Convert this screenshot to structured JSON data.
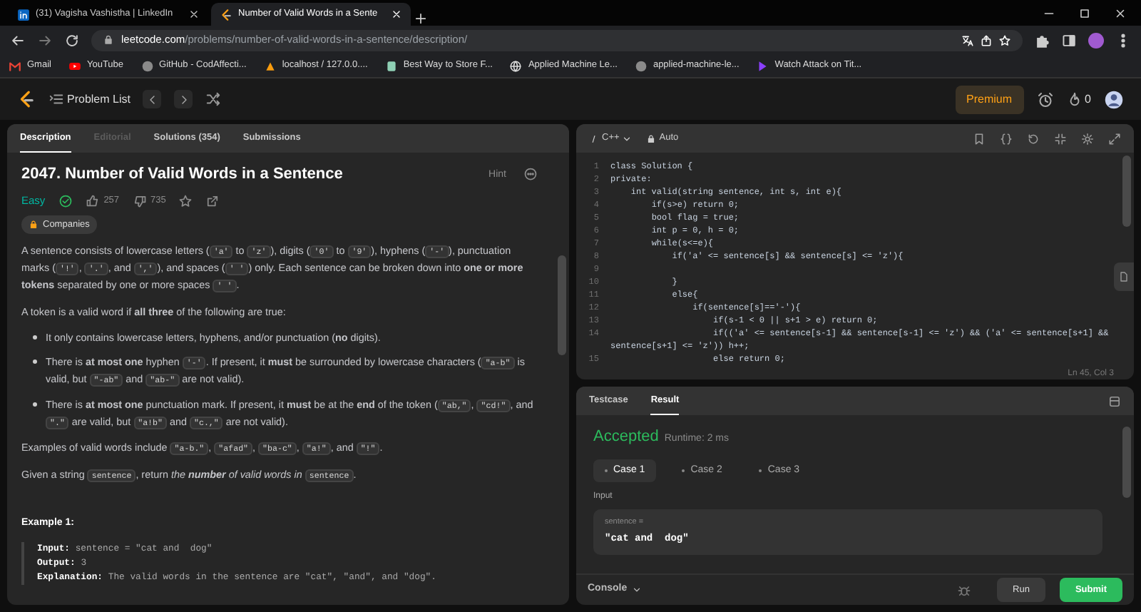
{
  "browser": {
    "tabs": [
      {
        "title": "(31) Vagisha Vashistha | LinkedIn",
        "kind": "square",
        "selected": false
      },
      {
        "title": "Number of Valid Words in a Sente",
        "kind": "bracket",
        "selected": true
      }
    ],
    "url_host": "leetcode.com",
    "url_path": "/problems/number-of-valid-words-in-a-sentence/description/",
    "bookmarks": [
      {
        "label": "Gmail",
        "kind": "mail"
      },
      {
        "label": "YouTube",
        "kind": "video"
      },
      {
        "label": "GitHub - CodAffecti...",
        "kind": "round"
      },
      {
        "label": "localhost / 127.0.0....",
        "kind": "sail"
      },
      {
        "label": "Best Way to Store F...",
        "kind": "page"
      },
      {
        "label": "Applied Machine Le...",
        "kind": "globe"
      },
      {
        "label": "applied-machine-le...",
        "kind": "round"
      },
      {
        "label": "Watch Attack on Tit...",
        "kind": "play"
      }
    ]
  },
  "nav": {
    "title": "Problem List",
    "premium": "Premium",
    "streak": "0"
  },
  "left": {
    "tabs": [
      {
        "label": "Description",
        "selected": true,
        "disabled": false
      },
      {
        "label": "Editorial",
        "selected": false,
        "disabled": true
      },
      {
        "label": "Solutions (354)",
        "selected": false,
        "disabled": false
      },
      {
        "label": "Submissions",
        "selected": false,
        "disabled": false
      }
    ]
  },
  "problem": {
    "title": "2047. Number of Valid Words in a Sentence",
    "hint": "Hint",
    "difficulty": "Easy",
    "solved": true,
    "likes": "257",
    "dislikes": "735",
    "tag": "Companies",
    "blocks": [
      {
        "kind": "paragraph",
        "segments": [
          {
            "kind": "text",
            "text": "A sentence consists of lowercase letters ("
          },
          {
            "kind": "code",
            "text": "'a'"
          },
          {
            "kind": "text",
            "text": " to "
          },
          {
            "kind": "code",
            "text": "'z'"
          },
          {
            "kind": "text",
            "text": "), digits ("
          },
          {
            "kind": "code",
            "text": "'0'"
          },
          {
            "kind": "text",
            "text": " to "
          },
          {
            "kind": "code",
            "text": "'9'"
          },
          {
            "kind": "text",
            "text": "), hyphens ("
          },
          {
            "kind": "code",
            "text": "'-'"
          },
          {
            "kind": "text",
            "text": "), punctuation marks ("
          },
          {
            "kind": "code",
            "text": "'!'"
          },
          {
            "kind": "text",
            "text": ", "
          },
          {
            "kind": "code",
            "text": "'.'"
          },
          {
            "kind": "text",
            "text": ", and "
          },
          {
            "kind": "code",
            "text": "','"
          },
          {
            "kind": "text",
            "text": "), and spaces ("
          },
          {
            "kind": "code",
            "text": "' '"
          },
          {
            "kind": "text",
            "text": ") only. Each sentence can be broken down into **one or more tokens** separated by one or more spaces "
          },
          {
            "kind": "code",
            "text": "' '"
          },
          {
            "kind": "text",
            "text": "."
          }
        ]
      },
      {
        "kind": "paragraph",
        "segments": [
          {
            "kind": "text",
            "text": "A token is a valid word if **all three** of the following are true:"
          }
        ]
      },
      {
        "kind": "bullet",
        "segments": [
          {
            "kind": "text",
            "text": "It only contains lowercase letters, hyphens, and/or punctuation (**no** digits)."
          }
        ]
      },
      {
        "kind": "bullet",
        "segments": [
          {
            "kind": "text",
            "text": "There is **at most one** hyphen "
          },
          {
            "kind": "code",
            "text": "'-'"
          },
          {
            "kind": "text",
            "text": ". If present, it **must** be surrounded by lowercase characters ("
          },
          {
            "kind": "code",
            "text": "\"a-b\""
          },
          {
            "kind": "text",
            "text": " is valid, but "
          },
          {
            "kind": "code",
            "text": "\"-ab\""
          },
          {
            "kind": "text",
            "text": " and "
          },
          {
            "kind": "code",
            "text": "\"ab-\""
          },
          {
            "kind": "text",
            "text": " are not valid)."
          }
        ]
      },
      {
        "kind": "bullet",
        "segments": [
          {
            "kind": "text",
            "text": "There is **at most one** punctuation mark. If present, it **must** be at the **end** of the token ("
          },
          {
            "kind": "code",
            "text": "\"ab,\""
          },
          {
            "kind": "text",
            "text": ", "
          },
          {
            "kind": "code",
            "text": "\"cd!\""
          },
          {
            "kind": "text",
            "text": ", and "
          },
          {
            "kind": "code",
            "text": "\".\""
          },
          {
            "kind": "text",
            "text": " are valid, but "
          },
          {
            "kind": "code",
            "text": "\"a!b\""
          },
          {
            "kind": "text",
            "text": " and "
          },
          {
            "kind": "code",
            "text": "\"c.,\""
          },
          {
            "kind": "text",
            "text": " are not valid)."
          }
        ]
      },
      {
        "kind": "paragraph",
        "segments": [
          {
            "kind": "text",
            "text": "Examples of valid words include "
          },
          {
            "kind": "code",
            "text": "\"a-b.\""
          },
          {
            "kind": "text",
            "text": ", "
          },
          {
            "kind": "code",
            "text": "\"afad\""
          },
          {
            "kind": "text",
            "text": ", "
          },
          {
            "kind": "code",
            "text": "\"ba-c\""
          },
          {
            "kind": "text",
            "text": ", "
          },
          {
            "kind": "code",
            "text": "\"a!\""
          },
          {
            "kind": "text",
            "text": ", and "
          },
          {
            "kind": "code",
            "text": "\"!\""
          },
          {
            "kind": "text",
            "text": "."
          }
        ]
      },
      {
        "kind": "paragraph",
        "segments": [
          {
            "kind": "text",
            "text": "Given a string "
          },
          {
            "kind": "code",
            "text": "sentence"
          },
          {
            "kind": "text",
            "text": ", return "
          },
          {
            "kind": "em",
            "text": "the **number** of valid words in "
          },
          {
            "kind": "code",
            "text": "sentence"
          },
          {
            "kind": "text",
            "text": "."
          }
        ]
      }
    ],
    "example": {
      "heading": "Example 1:",
      "lines": [
        {
          "label": "Input:",
          "value": "sentence = \"cat and  dog\""
        },
        {
          "label": "Output:",
          "value": "3"
        },
        {
          "label": "Explanation:",
          "value": "The valid words in the sentence are \"cat\", \"and\", and \"dog\"."
        }
      ]
    }
  },
  "editor": {
    "language": "C++",
    "mode": "Auto",
    "cursor": "Ln 45, Col 3",
    "code_lines": [
      {
        "number": "1",
        "text": "class Solution {"
      },
      {
        "number": "2",
        "text": "private:"
      },
      {
        "number": "3",
        "text": "    int valid(string sentence, int s, int e){"
      },
      {
        "number": "4",
        "text": "        if(s>e) return 0;"
      },
      {
        "number": "5",
        "text": "        bool flag = true;"
      },
      {
        "number": "6",
        "text": "        int p = 0, h = 0;"
      },
      {
        "number": "7",
        "text": "        while(s<=e){"
      },
      {
        "number": "8",
        "text": "            if('a' <= sentence[s] && sentence[s] <= 'z'){"
      },
      {
        "number": "9"
      },
      {
        "number": "10",
        "text": "            }"
      },
      {
        "number": "11",
        "text": "            else{"
      },
      {
        "number": "12",
        "text": "                if(sentence[s]=='-'){"
      },
      {
        "number": "13",
        "text": "                    if(s-1 < 0 || s+1 > e) return 0;"
      },
      {
        "number": "14",
        "text": "                    if(('a' <= sentence[s-1] && sentence[s-1] <= 'z') && ('a' <= sentence[s+1] && sentence[s+1] <= 'z')) h++;"
      },
      {
        "number": "15",
        "text": "                    else return 0;"
      }
    ]
  },
  "result": {
    "tabs": [
      {
        "label": "Testcase",
        "selected": false
      },
      {
        "label": "Result",
        "selected": true
      }
    ],
    "verdict": "Accepted",
    "runtime": "Runtime: 2 ms",
    "cases": [
      {
        "label": "Case 1",
        "selected": true
      },
      {
        "label": "Case 2",
        "selected": false
      },
      {
        "label": "Case 3",
        "selected": false
      }
    ],
    "input_label": "Input",
    "var_name": "sentence =",
    "var_value": "\"cat and  dog\"",
    "console": "Console",
    "run": "Run",
    "submit": "Submit"
  }
}
